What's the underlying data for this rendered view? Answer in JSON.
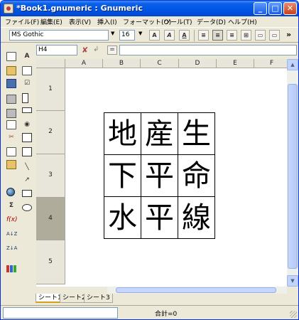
{
  "window": {
    "title": "*Book1.gnumeric : Gnumeric"
  },
  "menu": [
    {
      "label": "ファイル(F)"
    },
    {
      "label": "編集(E)"
    },
    {
      "label": "表示(V)"
    },
    {
      "label": "挿入(I)"
    },
    {
      "label": "フォーマット(O)"
    },
    {
      "label": "ツール(T)"
    },
    {
      "label": "データ(D)"
    },
    {
      "label": "ヘルプ(H)"
    }
  ],
  "toolbar": {
    "font_name": "MS Gothic",
    "font_size": "16",
    "bold": "A",
    "italic": "A",
    "underline": "A",
    "more": "»"
  },
  "editline": {
    "cell_ref": "H4",
    "formula": "",
    "equal_label": "="
  },
  "columns": [
    "A",
    "B",
    "C",
    "D",
    "E",
    "F"
  ],
  "rows": [
    "1",
    "2",
    "3",
    "4",
    "5"
  ],
  "active_row": "4",
  "cells": [
    [
      "地",
      "産",
      "生"
    ],
    [
      "下",
      "平",
      "命"
    ],
    [
      "水",
      "平",
      "線"
    ]
  ],
  "sheet_tabs": [
    "シート1",
    "シート2",
    "シート3"
  ],
  "status": {
    "sum": "合計=0"
  }
}
